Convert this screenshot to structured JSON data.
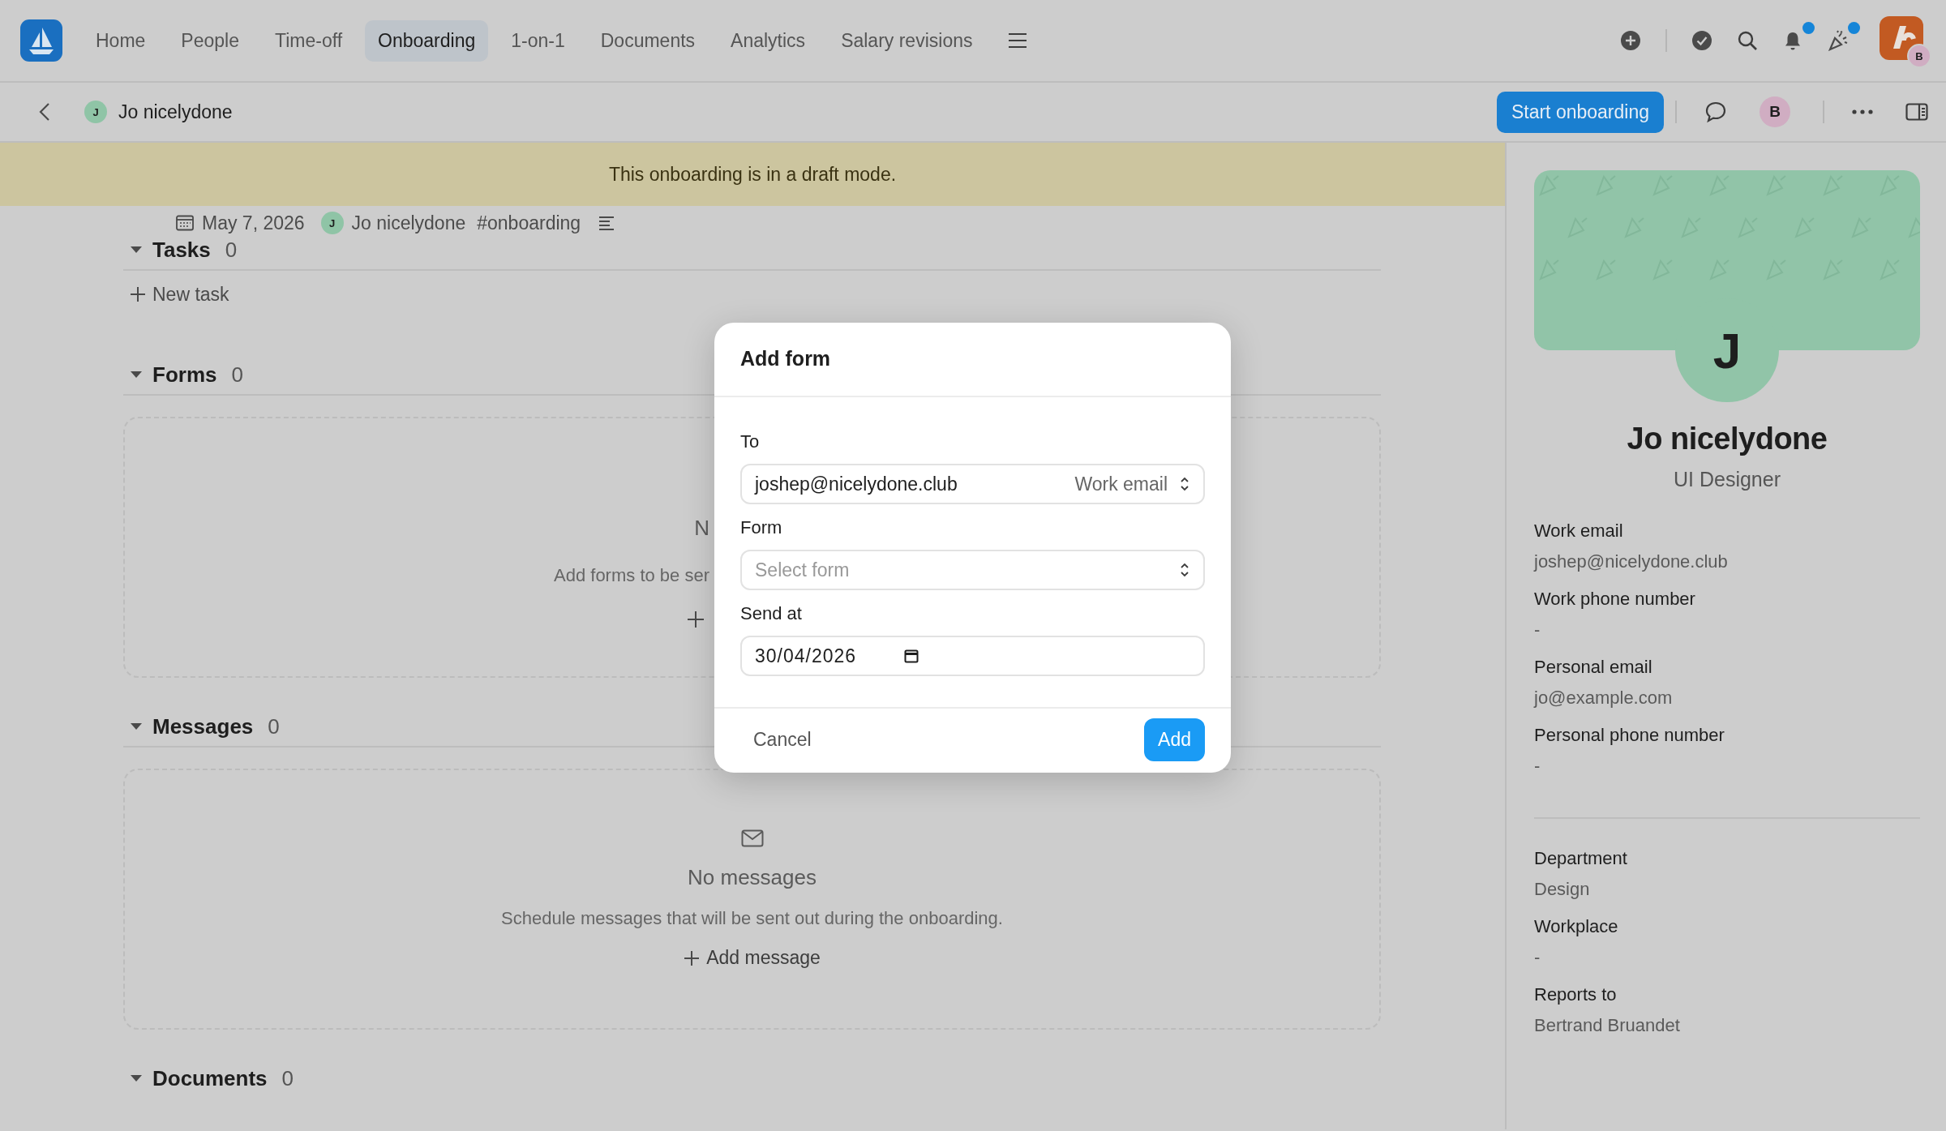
{
  "top_nav": {
    "tabs": [
      {
        "label": "Home",
        "selected": false
      },
      {
        "label": "People",
        "selected": false
      },
      {
        "label": "Time-off",
        "selected": false
      },
      {
        "label": "Onboarding",
        "selected": true
      },
      {
        "label": "1-on-1",
        "selected": false
      },
      {
        "label": "Documents",
        "selected": false
      },
      {
        "label": "Analytics",
        "selected": false
      },
      {
        "label": "Salary revisions",
        "selected": false
      }
    ],
    "tools": [
      {
        "kind": "add",
        "unread": false
      },
      {
        "kind": "tasks",
        "unread": false
      },
      {
        "kind": "search",
        "unread": false
      },
      {
        "kind": "notifications",
        "unread": true
      },
      {
        "kind": "celebrations",
        "unread": true
      }
    ],
    "account_badge": "B"
  },
  "header": {
    "avatar": "J",
    "name": "Jo nicelydone",
    "primary_button": "Start onboarding",
    "user_avatar": "B"
  },
  "banner": "This onboarding is in a draft mode.",
  "meta": {
    "date": "May 7, 2026",
    "avatar": "J",
    "owner": "Jo nicelydone",
    "tag": "#onboarding"
  },
  "sections": [
    {
      "kind": "tasks",
      "title": "Tasks",
      "count": "0",
      "action": "New task"
    },
    {
      "kind": "forms",
      "title": "Forms",
      "count": "0",
      "empty_title": "N",
      "empty_text": "Add forms to be ser"
    },
    {
      "kind": "messages",
      "title": "Messages",
      "count": "0",
      "empty_title": "No messages",
      "empty_text": "Schedule messages that will be sent out during the onboarding.",
      "action": "Add message"
    },
    {
      "kind": "documents",
      "title": "Documents",
      "count": "0"
    }
  ],
  "dialog": {
    "title": "Add form",
    "to_label": "To",
    "to_value": "joshep@nicelydone.club",
    "to_type": "Work email",
    "form_label": "Form",
    "form_placeholder": "Select form",
    "send_label": "Send at",
    "send_value": "30/04/2026",
    "cancel": "Cancel",
    "confirm": "Add"
  },
  "profile": {
    "avatar": "J",
    "name": "Jo nicelydone",
    "role": "UI Designer",
    "groups": [
      {
        "fields": [
          {
            "label": "Work email",
            "value": "joshep@nicelydone.club"
          },
          {
            "label": "Work phone number",
            "value": "-"
          },
          {
            "label": "Personal email",
            "value": "jo@example.com"
          },
          {
            "label": "Personal phone number",
            "value": "-"
          }
        ]
      },
      {
        "fields": [
          {
            "label": "Department",
            "value": "Design"
          },
          {
            "label": "Workplace",
            "value": "-"
          },
          {
            "label": "Reports to",
            "value": "Bertrand Bruandet"
          }
        ]
      }
    ]
  }
}
